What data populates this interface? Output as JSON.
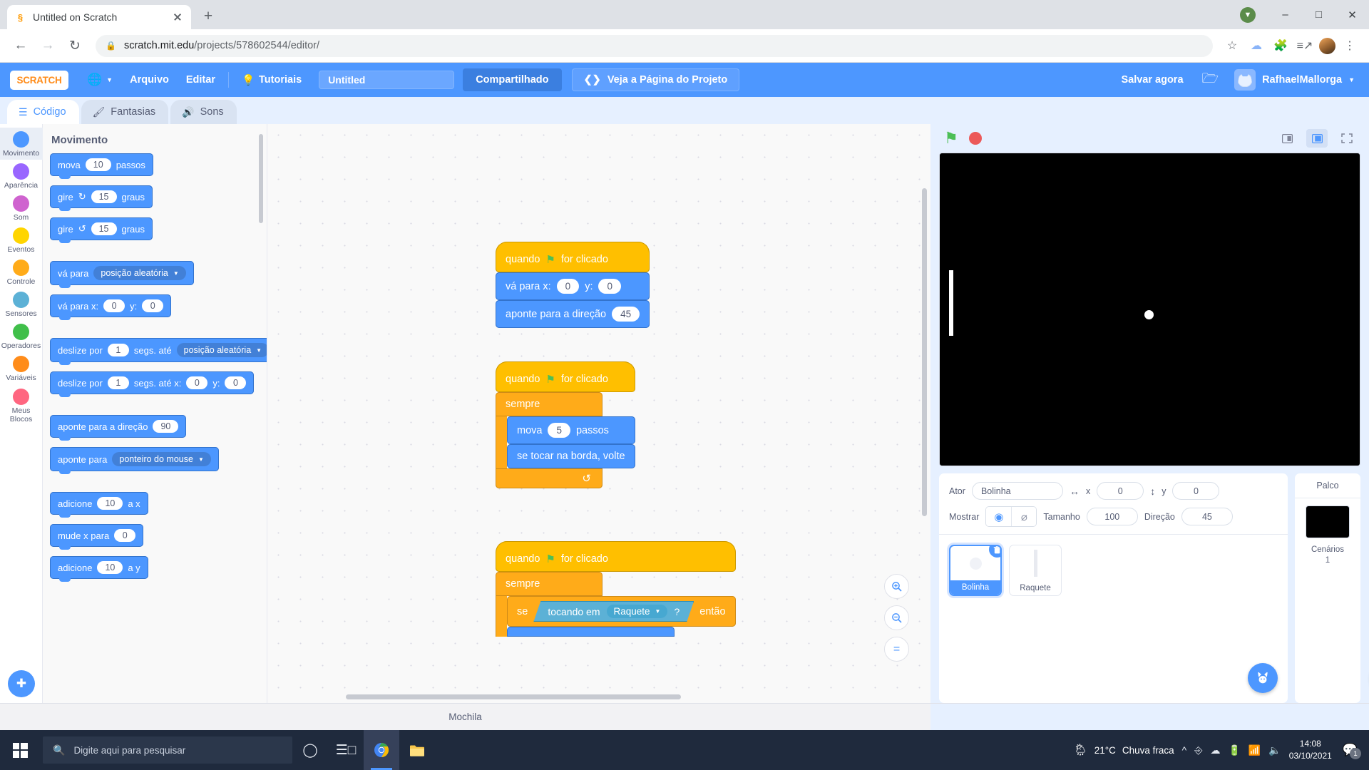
{
  "browser": {
    "tab": {
      "title": "Untitled on Scratch",
      "favicon": "scratch-favicon"
    },
    "newtab_label": "+",
    "window_controls": {
      "minimize": "–",
      "maximize": "□",
      "close": "✕",
      "update": "▼"
    },
    "nav": {
      "back": "←",
      "forward": "→",
      "reload": "↻"
    },
    "url_secure": "scratch.mit.edu",
    "url_path": "/projects/578602544/editor/",
    "toolbar_icons": [
      "bookmark-star-icon",
      "cloud-icon",
      "extensions-icon",
      "reading-list-icon",
      "profile-avatar",
      "chrome-menu-icon"
    ]
  },
  "menubar": {
    "logo_text": "SCRATCH",
    "globe_label": "⊕",
    "file_menu": "Arquivo",
    "edit_menu": "Editar",
    "tutorials": "Tutoriais",
    "project_name": "Untitled",
    "share_button": "Compartilhado",
    "project_page_button": "Veja a Página do Projeto",
    "save_now": "Salvar agora",
    "username": "RafhaelMallorga"
  },
  "editor_tabs": [
    {
      "label": "Código",
      "icon": "code-icon",
      "active": true
    },
    {
      "label": "Fantasias",
      "icon": "brush-icon",
      "active": false
    },
    {
      "label": "Sons",
      "icon": "speaker-icon",
      "active": false
    }
  ],
  "categories": [
    {
      "label": "Movimento",
      "color": "#4c97ff",
      "selected": true
    },
    {
      "label": "Aparência",
      "color": "#9966ff",
      "selected": false
    },
    {
      "label": "Som",
      "color": "#cf63cf",
      "selected": false
    },
    {
      "label": "Eventos",
      "color": "#ffd500",
      "selected": false
    },
    {
      "label": "Controle",
      "color": "#ffab19",
      "selected": false
    },
    {
      "label": "Sensores",
      "color": "#5cb1d6",
      "selected": false
    },
    {
      "label": "Operadores",
      "color": "#40bf4a",
      "selected": false
    },
    {
      "label": "Variáveis",
      "color": "#ff8c1a",
      "selected": false
    },
    {
      "label": "Meus Blocos",
      "color": "#ff6680",
      "selected": false
    }
  ],
  "palette": {
    "header": "Movimento",
    "blocks": [
      {
        "id": "move",
        "parts": [
          {
            "t": "text",
            "v": "mova"
          },
          {
            "t": "oval",
            "v": "10"
          },
          {
            "t": "text",
            "v": "passos"
          }
        ]
      },
      {
        "id": "turn-right",
        "parts": [
          {
            "t": "text",
            "v": "gire"
          },
          {
            "t": "icon",
            "v": "↻"
          },
          {
            "t": "oval",
            "v": "15"
          },
          {
            "t": "text",
            "v": "graus"
          }
        ]
      },
      {
        "id": "turn-left",
        "parts": [
          {
            "t": "text",
            "v": "gire"
          },
          {
            "t": "icon",
            "v": "↺"
          },
          {
            "t": "oval",
            "v": "15"
          },
          {
            "t": "text",
            "v": "graus"
          }
        ]
      },
      {
        "id": "goto-random",
        "gap": true,
        "parts": [
          {
            "t": "text",
            "v": "vá para"
          },
          {
            "t": "drop",
            "v": "posição aleatória"
          }
        ]
      },
      {
        "id": "goto-xy",
        "parts": [
          {
            "t": "text",
            "v": "vá para x:"
          },
          {
            "t": "oval",
            "v": "0"
          },
          {
            "t": "text",
            "v": "y:"
          },
          {
            "t": "oval",
            "v": "0"
          }
        ]
      },
      {
        "id": "glide-random",
        "gap": true,
        "parts": [
          {
            "t": "text",
            "v": "deslize por"
          },
          {
            "t": "oval",
            "v": "1"
          },
          {
            "t": "text",
            "v": "segs. até"
          },
          {
            "t": "drop",
            "v": "posição aleatória"
          }
        ]
      },
      {
        "id": "glide-xy",
        "parts": [
          {
            "t": "text",
            "v": "deslize por"
          },
          {
            "t": "oval",
            "v": "1"
          },
          {
            "t": "text",
            "v": "segs. até x:"
          },
          {
            "t": "oval",
            "v": "0"
          },
          {
            "t": "text",
            "v": "y:"
          },
          {
            "t": "oval",
            "v": "0"
          }
        ]
      },
      {
        "id": "point-direction",
        "gap": true,
        "parts": [
          {
            "t": "text",
            "v": "aponte  para a direção"
          },
          {
            "t": "oval",
            "v": "90"
          }
        ]
      },
      {
        "id": "point-towards",
        "parts": [
          {
            "t": "text",
            "v": "aponte para"
          },
          {
            "t": "drop",
            "v": "ponteiro do mouse"
          }
        ]
      },
      {
        "id": "change-x",
        "gap": true,
        "parts": [
          {
            "t": "text",
            "v": "adicione"
          },
          {
            "t": "oval",
            "v": "10"
          },
          {
            "t": "text",
            "v": "a x"
          }
        ]
      },
      {
        "id": "set-x",
        "parts": [
          {
            "t": "text",
            "v": "mude x para"
          },
          {
            "t": "oval",
            "v": "0"
          }
        ]
      },
      {
        "id": "change-y",
        "parts": [
          {
            "t": "text",
            "v": "adicione"
          },
          {
            "t": "oval",
            "v": "10"
          },
          {
            "t": "text",
            "v": "a y"
          }
        ]
      }
    ]
  },
  "scripts": {
    "script1": {
      "hat": {
        "pre": "quando",
        "flag": "⚑",
        "post": "for clicado"
      },
      "blocks": [
        {
          "parts": [
            {
              "t": "text",
              "v": "vá para x:"
            },
            {
              "t": "oval",
              "v": "0"
            },
            {
              "t": "text",
              "v": "y:"
            },
            {
              "t": "oval",
              "v": "0"
            }
          ]
        },
        {
          "parts": [
            {
              "t": "text",
              "v": "aponte  para a direção"
            },
            {
              "t": "oval",
              "v": "45"
            }
          ]
        }
      ]
    },
    "script2": {
      "hat": {
        "pre": "quando",
        "flag": "⚑",
        "post": "for clicado"
      },
      "loop_label": "sempre",
      "loop_arrow": "↺",
      "inner": [
        {
          "parts": [
            {
              "t": "text",
              "v": "mova"
            },
            {
              "t": "oval",
              "v": "5"
            },
            {
              "t": "text",
              "v": "passos"
            }
          ]
        },
        {
          "parts": [
            {
              "t": "text",
              "v": "se tocar na borda, volte"
            }
          ]
        }
      ]
    },
    "script3": {
      "hat": {
        "pre": "quando",
        "flag": "⚑",
        "post": "for clicado"
      },
      "loop_label": "sempre",
      "if_prefix": "se",
      "condition_label": "tocando em",
      "condition_value": "Raquete",
      "condition_q": "?",
      "if_suffix": "então"
    }
  },
  "canvas_zoom": {
    "in": "+",
    "out": "–",
    "reset": "="
  },
  "stage": {
    "green_flag": "⚑",
    "stop": "stop-icon",
    "layout_small": "small-stage-icon",
    "layout_large": "large-stage-icon",
    "fullscreen": "fullscreen-icon"
  },
  "sprite_info": {
    "sprite_label": "Ator",
    "sprite_name": "Bolinha",
    "x_label": "x",
    "x_value": "0",
    "y_label": "y",
    "y_value": "0",
    "show_label": "Mostrar",
    "show_on": "◉",
    "show_off": "⌀",
    "size_label": "Tamanho",
    "size_value": "100",
    "direction_label": "Direção",
    "direction_value": "45"
  },
  "sprites": [
    {
      "name": "Bolinha",
      "selected": true,
      "thumb": "ball-thumb",
      "delete_badge": "␡"
    },
    {
      "name": "Raquete",
      "selected": false,
      "thumb": "paddle-thumb"
    }
  ],
  "sprite_fab": "choose-sprite-icon",
  "stage_panel": {
    "title": "Palco",
    "backdrops_label": "Cenários",
    "backdrops_count": "1",
    "fab": "choose-backdrop-icon"
  },
  "backpack": {
    "label": "Mochila"
  },
  "taskbar": {
    "search_placeholder": "Digite aqui para pesquisar",
    "apps": [
      "cortana-icon",
      "task-view-icon",
      "chrome-icon",
      "file-explorer-icon"
    ],
    "weather_temp": "21°C",
    "weather_desc": "Chuva fraca",
    "tray_icons": [
      "chevron-up-icon",
      "onedrive-sync-icon",
      "cloud-icon",
      "battery-icon",
      "wifi-icon",
      "volume-icon"
    ],
    "time": "14:08",
    "date": "03/10/2021",
    "notification_count": "1"
  }
}
